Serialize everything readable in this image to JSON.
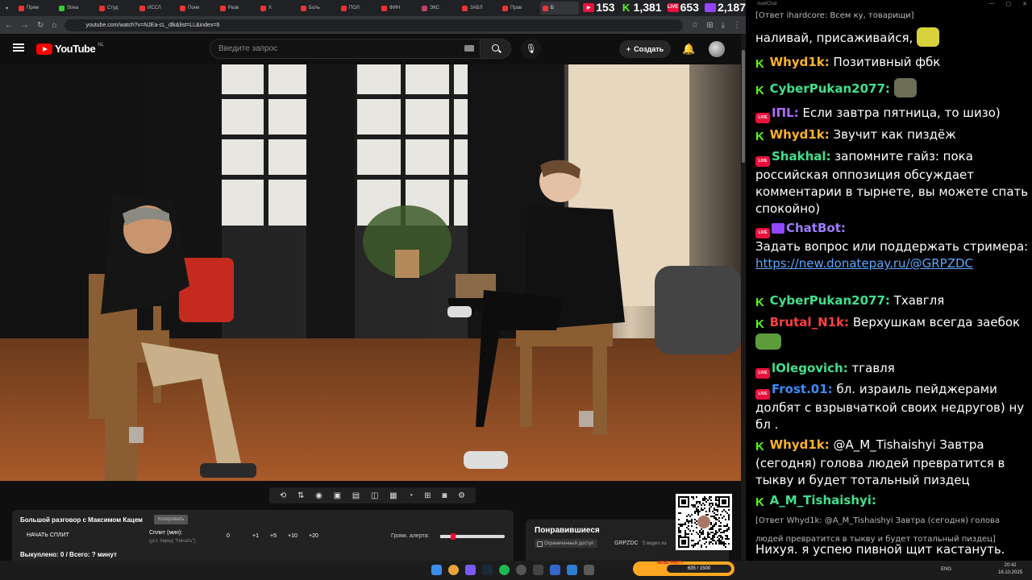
{
  "browser": {
    "tabs": [
      {
        "label": "Прям",
        "favicon": "youtube-icon"
      },
      {
        "label": "Strea",
        "favicon": "kick-icon"
      },
      {
        "label": "Студ",
        "favicon": "youtube-icon"
      },
      {
        "label": "ИССЛ",
        "favicon": "youtube-icon"
      },
      {
        "label": "Пони",
        "favicon": "youtube-icon"
      },
      {
        "label": "Разв",
        "favicon": "youtube-icon"
      },
      {
        "label": "Х",
        "favicon": "youtube-icon"
      },
      {
        "label": "Боль",
        "favicon": "youtube-icon"
      },
      {
        "label": "ПОЛ",
        "favicon": "youtube-icon"
      },
      {
        "label": "ФИН",
        "favicon": "youtube-icon"
      },
      {
        "label": "ЭКС",
        "favicon": "generic-icon"
      },
      {
        "label": "ЗАБЛ",
        "favicon": "youtube-icon"
      },
      {
        "label": "Прав",
        "favicon": "youtube-icon"
      },
      {
        "label": "Б",
        "favicon": "youtube-icon"
      }
    ],
    "url": "youtube.com/watch?v=NJEa-cL_dlk&list=LL&index=6"
  },
  "viewer_stats": [
    {
      "platform": "youtube",
      "count": "153"
    },
    {
      "platform": "kick",
      "count": "1,381"
    },
    {
      "platform": "vkplay",
      "count": "653"
    },
    {
      "platform": "twitch",
      "count": "2,187"
    }
  ],
  "youtube": {
    "logo_text": "YouTube",
    "region": "NL",
    "search_placeholder": "Введите запрос",
    "create_label": "Создать"
  },
  "toolbar": {
    "icons": [
      "loop-icon",
      "sort-icon",
      "audio-wave-icon",
      "cinema-icon",
      "theater-icon",
      "picture-in-picture-icon",
      "filmstrip-icon",
      "speedometer-icon",
      "screenshot-plus-icon",
      "camera-icon",
      "gear-icon"
    ]
  },
  "info_panel": {
    "title": "Большой разговор с Максимом Кацем",
    "copy_label": "Копировать",
    "start_split": "НАЧАТЬ СПЛИТ",
    "split_label": "Сплит (мин):",
    "split_hint": "(уст. перед \"Начать\")",
    "split_value": "0",
    "increments": [
      "+1",
      "+5",
      "+10",
      "+20"
    ],
    "alert_label": "Громк. алерта:",
    "alert_volume": 0.2,
    "bought": "Выкуплено: 0 / Всего: ? минут"
  },
  "liked": {
    "title": "Понравившиеся",
    "restricted": "Ограниченный доступ",
    "channel": "GRPZDC",
    "count": "5 видео из"
  },
  "chat": {
    "window_title": "AxelChat",
    "messages": [
      {
        "platform": "reply",
        "text": "[Ответ ihardcore: Всем ку, товарищи]"
      },
      {
        "platform": "none",
        "text": "наливай, присаживайся,"
      },
      {
        "platform": "kick",
        "nick": "Whyd1k:",
        "nick_color": "#ffb22c",
        "text": " Позитивный фбк"
      },
      {
        "platform": "kick",
        "nick": "CyberPukan2077:",
        "nick_color": "#41e08c",
        "text": ""
      },
      {
        "platform": "live",
        "nick": "ΙΠL:",
        "nick_color": "#b06aff",
        "text": " Если завтра пятница, то шизо)"
      },
      {
        "platform": "kick",
        "nick": "Whyd1k:",
        "nick_color": "#ffb22c",
        "text": " Звучит как пиздёж"
      },
      {
        "platform": "live",
        "nick": "Shakhal:",
        "nick_color": "#41e08c",
        "text": " запомните гайз: пока российская оппозиция обсуждает комментарии в тырнете, вы можете спать спокойно)"
      },
      {
        "platform": "bot",
        "nick": "ChatBot:",
        "nick_color": "#a07cff",
        "text": "Задать вопрос или поддержать стримера:",
        "link": "https://new.donatepay.ru/@GRPZDC"
      },
      {
        "platform": "kick",
        "nick": "CyberPukan2077:",
        "nick_color": "#41e08c",
        "text": " Тхавгля"
      },
      {
        "platform": "kick",
        "nick": "Brutal_N1k:",
        "nick_color": "#ff4040",
        "text": " Верхушкам всегда заебок"
      },
      {
        "platform": "live",
        "nick": "lOlegovich:",
        "nick_color": "#41e08c",
        "text": " тгавля"
      },
      {
        "platform": "live",
        "nick": "Frost.01:",
        "nick_color": "#3b8cff",
        "text": " бл. израиль пейджерами долбят с взрывчаткой своих недругов) ну бл ."
      },
      {
        "platform": "kick",
        "nick": "Whyd1k:",
        "nick_color": "#ffb22c",
        "text": " @A_M_Tishaishyi Завтра (сегодня) голова людей превратится в тыкву и будет тотальный пиздец"
      },
      {
        "platform": "kick",
        "nick": "A_M_Tishaishyi:",
        "nick_color": "#41e08c",
        "text": "",
        "reply": "[Ответ Whyd1k: @A_M_Tishaishyi Завтра (сегодня) голова людей превратится в тыкву и будет тотальный пиздец]"
      },
      {
        "platform": "none",
        "text": "Нихуя. я успею пивной щит кастануть."
      }
    ]
  },
  "taskbar": {
    "meme_label": "MEME PARTY",
    "meme_progress": "635 / 1500",
    "lang": "ENG",
    "time": "20:42",
    "date": "16.10.2025"
  }
}
